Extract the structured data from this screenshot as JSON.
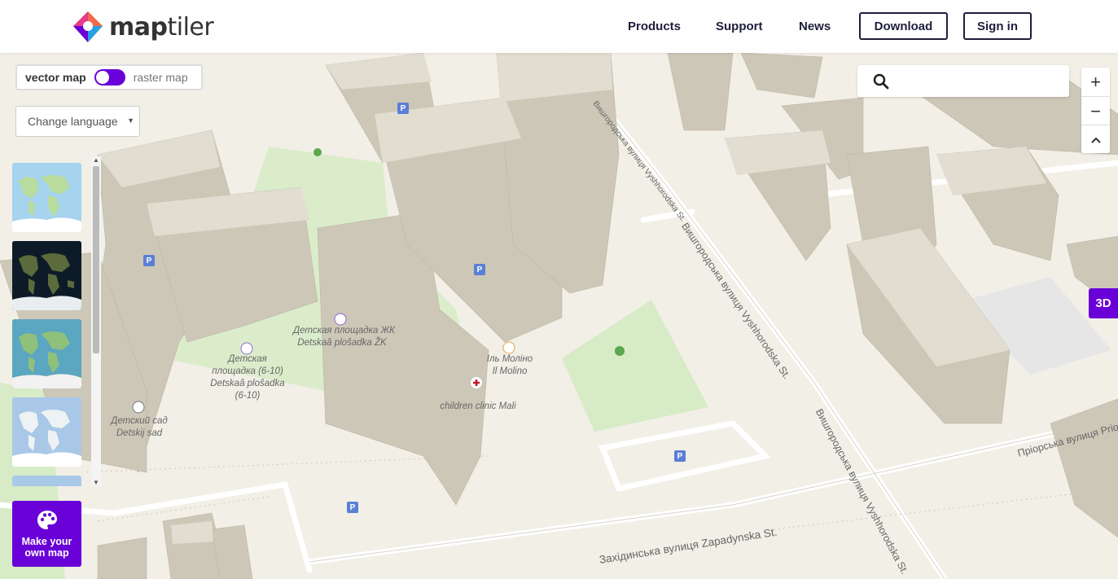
{
  "header": {
    "logo_text_a": "map",
    "logo_text_b": "tiler",
    "nav": [
      "Products",
      "Support",
      "News"
    ],
    "download_label": "Download",
    "signin_label": "Sign in"
  },
  "map_toggle": {
    "vector_label": "vector map",
    "raster_label": "raster map",
    "vector_selected": true
  },
  "language_select": {
    "value": "Change language"
  },
  "style_thumbnails": [
    {
      "name": "streets",
      "theme": "light-blue"
    },
    {
      "name": "satellite",
      "theme": "dark"
    },
    {
      "name": "outdoor",
      "theme": "teal"
    },
    {
      "name": "basic",
      "theme": "pale-blue"
    },
    {
      "name": "ocean",
      "theme": "pale-blue"
    }
  ],
  "make_map": {
    "label": "Make your own map",
    "icon": "palette-icon"
  },
  "controls": {
    "zoom_in": "+",
    "zoom_out": "−",
    "reset_north": "^",
    "three_d": "3D"
  },
  "poi_labels": [
    {
      "name": "playground-zk",
      "text": "Детская площадка ЖК\nDetskaâ ploŝadka ŽK"
    },
    {
      "name": "playground-6-10",
      "text": "Детская\nплощадка (6-10)\nDetskaâ ploŝadka\n(6-10)"
    },
    {
      "name": "kindergarten",
      "text": "Детский сад\nDetskij sad"
    },
    {
      "name": "restaurant",
      "text": "Іль Моліно\nIl Molino"
    },
    {
      "name": "clinic",
      "text": "children clinic Mali"
    }
  ],
  "road_labels": {
    "vyshhorodska_top": "Вишгородська вулиця Vyshhorodska St.",
    "vyshhorodska_mid": "Вишгородська вулиця Vyshhorodska St.",
    "vyshhorodska_bottom": "Вишгородська вулиця Vyshhorodska St.",
    "zapadynska": "Західинська вулиця Zapadynska St.",
    "priorska": "Пріорська вулиця Priorska"
  },
  "colors": {
    "brand": "#6a00d8",
    "land": "#f1efe6",
    "park": "#d9ecc9",
    "building": "#cfc9bb",
    "parking": "#5b7fd6"
  }
}
